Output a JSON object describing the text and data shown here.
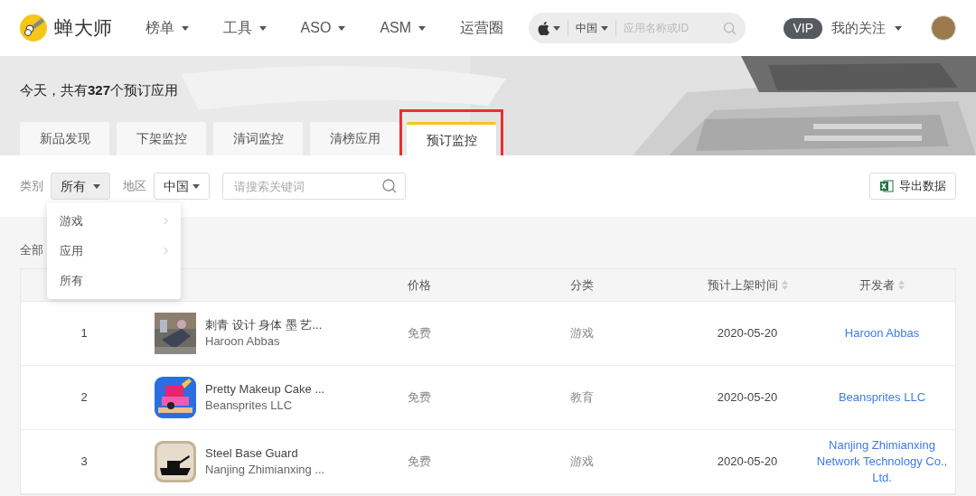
{
  "header": {
    "logo_text": "蝉大师",
    "nav": [
      {
        "label": "榜单",
        "dropdown": true
      },
      {
        "label": "工具",
        "dropdown": true
      },
      {
        "label": "ASO",
        "dropdown": true
      },
      {
        "label": "ASM",
        "dropdown": true
      },
      {
        "label": "运营圈",
        "dropdown": false
      }
    ],
    "search": {
      "region": "中国",
      "placeholder": "应用名称或ID"
    },
    "vip": "VIP",
    "follow": "我的关注"
  },
  "banner": {
    "summary": "今天，共有**327**个预订应用"
  },
  "tabs": [
    {
      "label": "新品发现",
      "selected": false,
      "highlighted": false
    },
    {
      "label": "下架监控",
      "selected": false,
      "highlighted": false
    },
    {
      "label": "清词监控",
      "selected": false,
      "highlighted": false
    },
    {
      "label": "清榜应用",
      "selected": false,
      "highlighted": false
    },
    {
      "label": "预订监控",
      "selected": true,
      "highlighted": true
    }
  ],
  "filters": {
    "category_label": "类别",
    "category_value": "所有",
    "region_label": "地区",
    "region_value": "中国",
    "search_placeholder": "请搜索关键词",
    "export": "导出数据"
  },
  "category_menu": [
    {
      "label": "游戏",
      "submenu": true
    },
    {
      "label": "应用",
      "submenu": true
    },
    {
      "label": "所有",
      "submenu": false
    }
  ],
  "section_label": "全部",
  "table": {
    "columns": [
      {
        "label": "价格",
        "sortable": false
      },
      {
        "label": "分类",
        "sortable": false
      },
      {
        "label": "预计上架时间",
        "sortable": true
      },
      {
        "label": "开发者",
        "sortable": true
      }
    ],
    "rows": [
      {
        "rank": "1",
        "name": "刺青 设计 身体 墨 艺...",
        "publisher": "Haroon Abbas",
        "price": "免费",
        "category": "游戏",
        "date": "2020-05-20",
        "developer": "Haroon Abbas"
      },
      {
        "rank": "2",
        "name": "Pretty Makeup Cake ...",
        "publisher": "Beansprites LLC",
        "price": "免费",
        "category": "教育",
        "date": "2020-05-20",
        "developer": "Beansprites LLC",
        "kind": "cake"
      },
      {
        "rank": "3",
        "name": "Steel Base Guard",
        "publisher": "Nanjing Zhimianxing ...",
        "price": "免费",
        "category": "游戏",
        "date": "2020-05-20",
        "developer": "Nanjing Zhimianxing Network Technology Co., Ltd.",
        "kind": "tank"
      }
    ]
  }
}
